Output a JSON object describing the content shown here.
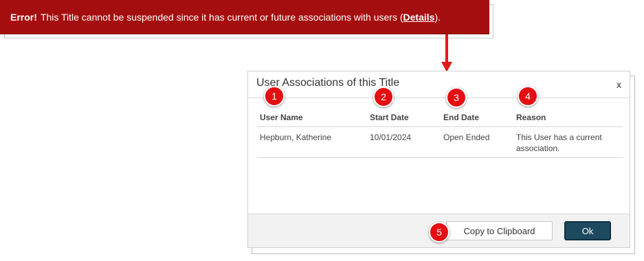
{
  "banner": {
    "error_label": "Error!",
    "message": "This Title cannot be suspended since it has current or future associations with users (",
    "details_link": "Details",
    "message_end": ")."
  },
  "dialog": {
    "title": "User Associations of this Title",
    "close_label": "x",
    "columns": [
      "User Name",
      "Start Date",
      "End Date",
      "Reason"
    ],
    "rows": [
      {
        "user_name": "Hepburn, Katherine",
        "start_date": "10/01/2024",
        "end_date": "Open Ended",
        "reason_line1": "This User has a current",
        "reason_line2": "association."
      }
    ],
    "copy_button": "Copy to Clipboard",
    "ok_button": "Ok"
  },
  "callouts": [
    "1",
    "2",
    "3",
    "4",
    "5"
  ],
  "colors": {
    "banner_bg": "#a50e0e",
    "callout": "#e50d12",
    "arrow": "#e0191d",
    "ok_button": "#1e4a5f"
  }
}
